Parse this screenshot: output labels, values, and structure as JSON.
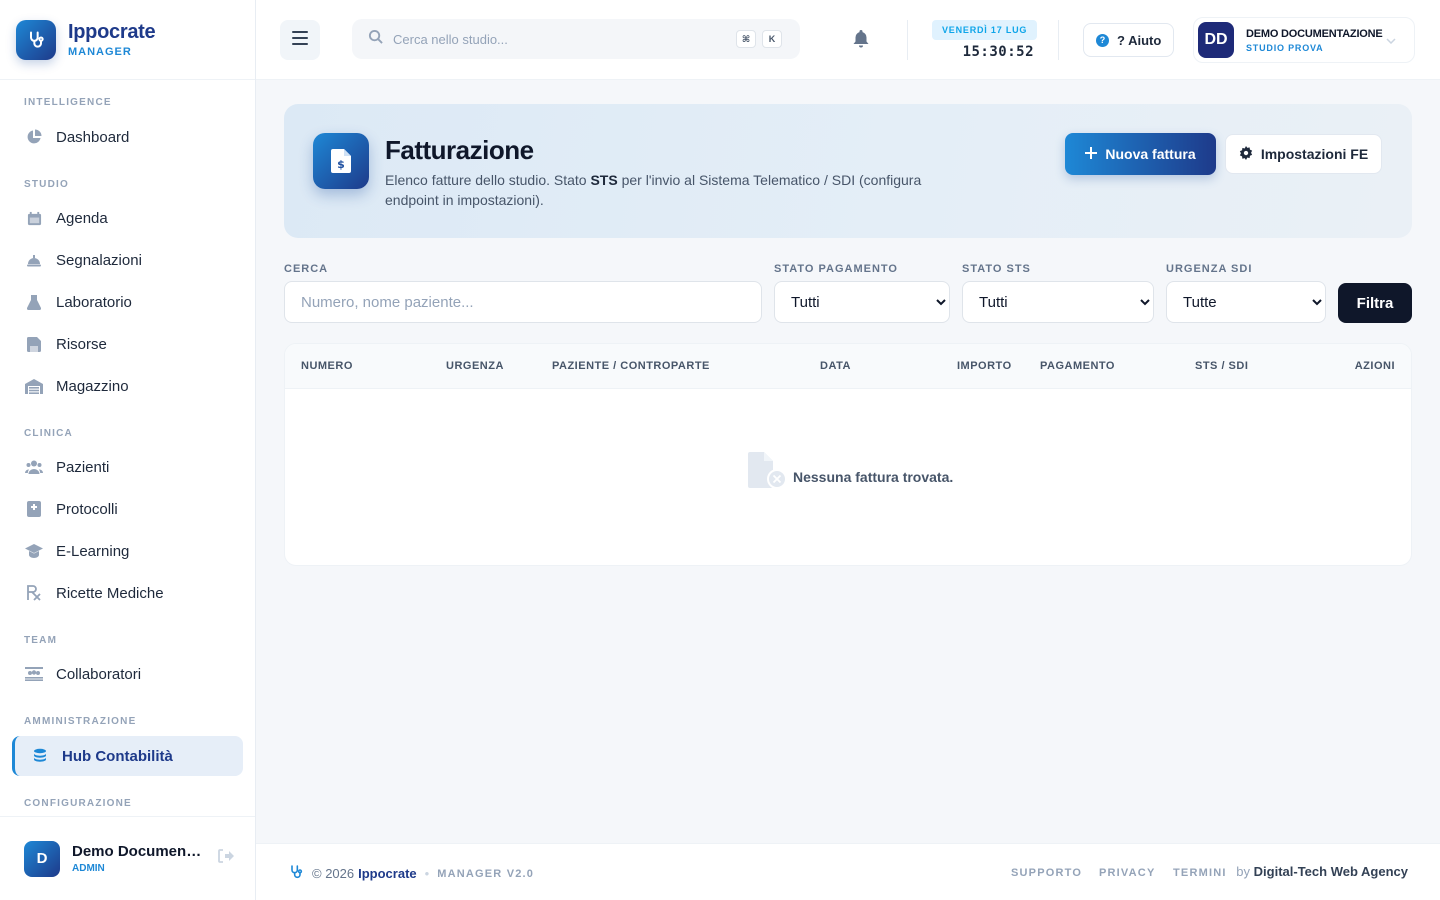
{
  "brand": {
    "name": "Ippocrate",
    "sub": "MANAGER"
  },
  "sidebar": {
    "sections": [
      {
        "label": "INTELLIGENCE",
        "items": [
          {
            "label": "Dashboard",
            "icon": "chart-pie-icon"
          }
        ]
      },
      {
        "label": "STUDIO",
        "items": [
          {
            "label": "Agenda",
            "icon": "calendar-icon"
          },
          {
            "label": "Segnalazioni",
            "icon": "bell-concierge-icon"
          },
          {
            "label": "Laboratorio",
            "icon": "flask-icon"
          },
          {
            "label": "Risorse",
            "icon": "floppy-icon"
          },
          {
            "label": "Magazzino",
            "icon": "warehouse-icon"
          }
        ]
      },
      {
        "label": "CLINICA",
        "items": [
          {
            "label": "Pazienti",
            "icon": "users-icon"
          },
          {
            "label": "Protocolli",
            "icon": "book-medical-icon"
          },
          {
            "label": "E-Learning",
            "icon": "graduation-cap-icon"
          },
          {
            "label": "Ricette Mediche",
            "icon": "prescription-icon"
          }
        ]
      },
      {
        "label": "TEAM",
        "items": [
          {
            "label": "Collaboratori",
            "icon": "people-group-icon"
          }
        ]
      },
      {
        "label": "AMMINISTRAZIONE",
        "items": [
          {
            "label": "Hub Contabilità",
            "icon": "coins-icon",
            "active": true
          }
        ]
      },
      {
        "label": "CONFIGURAZIONE",
        "items": []
      }
    ],
    "user": {
      "initial": "D",
      "name": "Demo Documentazione",
      "role": "ADMIN"
    }
  },
  "topbar": {
    "search_placeholder": "Cerca nello studio...",
    "kbd": [
      "⌘",
      "K"
    ],
    "date": "VENERDÌ 17 LUG",
    "time": "15:30:52",
    "help_label": "? Aiuto",
    "user": {
      "initials": "DD",
      "name": "DEMO DOCUMENTAZIONE",
      "sub": "STUDIO PROVA"
    }
  },
  "page": {
    "title": "Fatturazione",
    "desc_pre": "Elenco fatture dello studio. Stato ",
    "desc_bold": "STS",
    "desc_post": " per l'invio al Sistema Telematico / SDI (configura endpoint in impostazioni).",
    "new_button": "Nuova fattura",
    "settings_button": "Impostazioni FE"
  },
  "filters": {
    "search_label": "CERCA",
    "search_placeholder": "Numero, nome paziente...",
    "payment_label": "STATO PAGAMENTO",
    "payment_value": "Tutti",
    "sts_label": "STATO STS",
    "sts_value": "Tutti",
    "sdi_label": "URGENZA SDI",
    "sdi_value": "Tutte",
    "filter_button": "Filtra"
  },
  "table": {
    "headers": [
      "NUMERO",
      "URGENZA",
      "PAZIENTE / CONTROPARTE",
      "DATA",
      "IMPORTO",
      "PAGAMENTO",
      "STS / SDI",
      "AZIONI"
    ],
    "empty_text": "Nessuna fattura trovata."
  },
  "footer": {
    "copyright": "© 2026",
    "brand": "Ippocrate",
    "version": "MANAGER V2.0",
    "links": [
      "SUPPORTO",
      "PRIVACY",
      "TERMINI"
    ],
    "by_prefix": "by",
    "by_name": "Digital-Tech Web Agency"
  },
  "colors": {
    "accent": "#1e88d6",
    "brand_dark": "#1e3a8a",
    "dark_button": "#0f172a"
  }
}
